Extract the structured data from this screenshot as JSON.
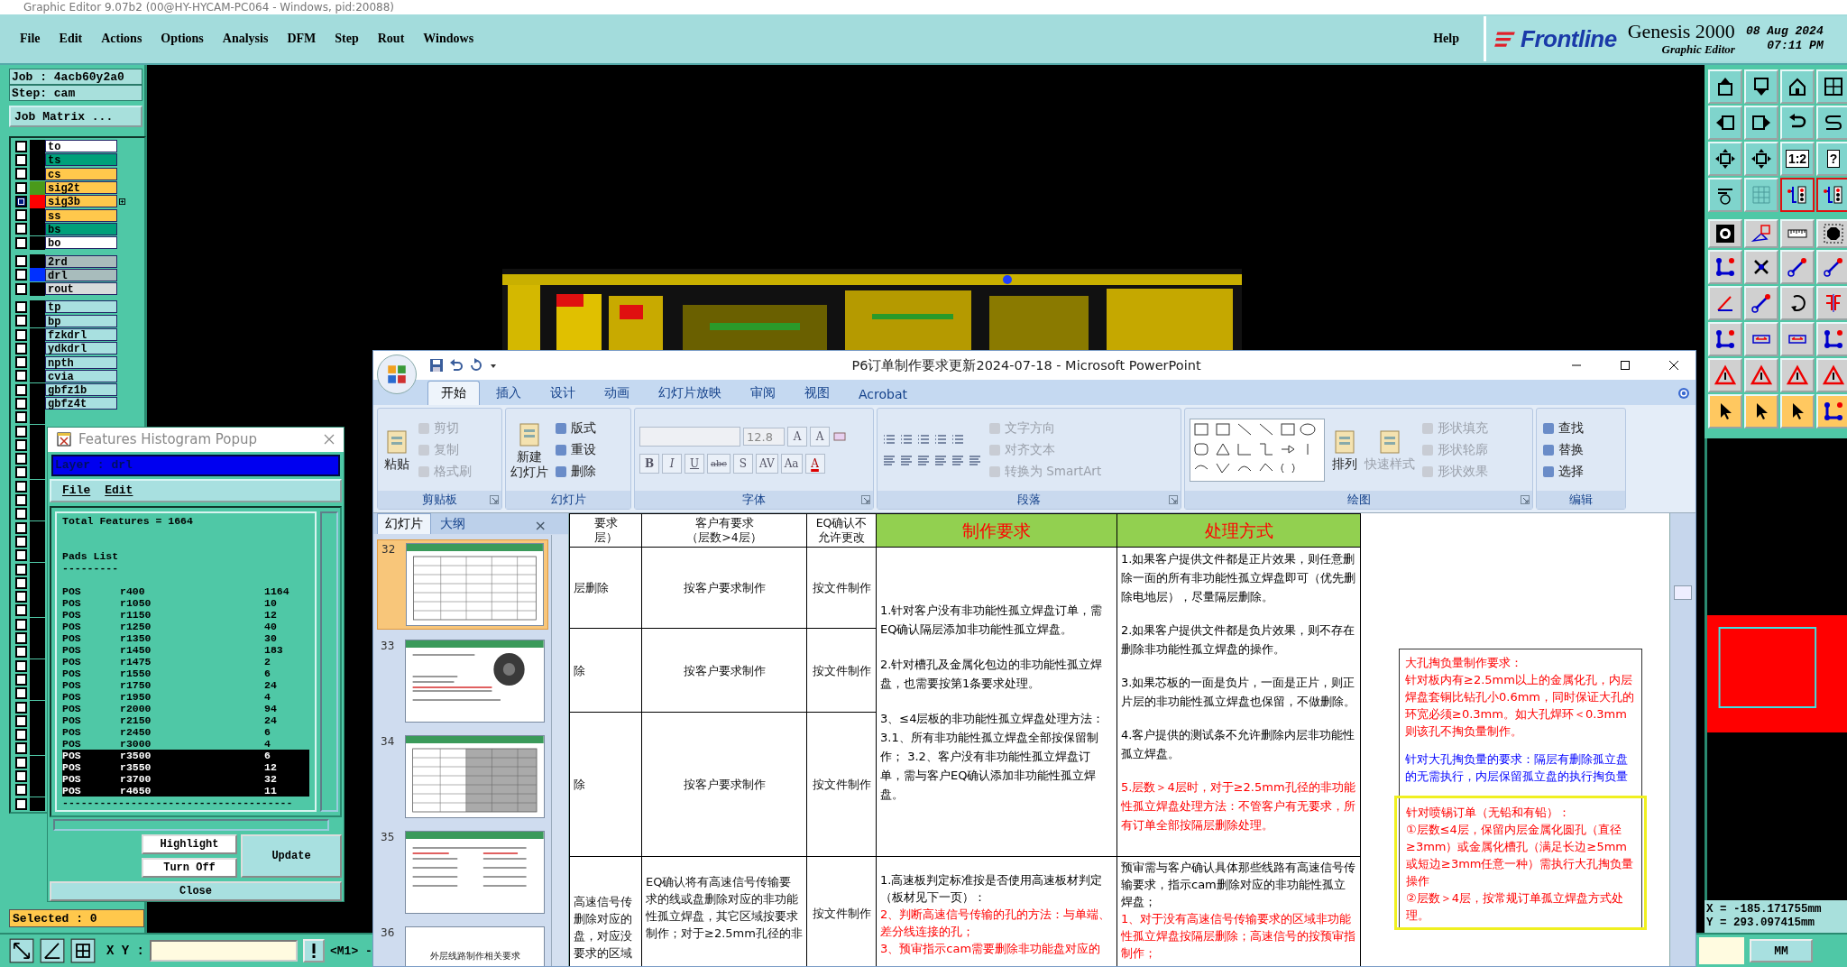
{
  "genesis": {
    "title": "Graphic Editor 9.07b2 (00@HY-HYCAM-PC064 - Windows, pid:20088)",
    "menu": [
      "File",
      "Edit",
      "Actions",
      "Options",
      "Analysis",
      "DFM",
      "Step",
      "Rout",
      "Windows"
    ],
    "help": "Help",
    "brand": {
      "logo": "Frontline",
      "product": "Genesis 2000",
      "subtitle": "Graphic Editor",
      "date": "08 Aug 2024",
      "time": "07:11 PM"
    },
    "job": "Job : 4acb60y2a0",
    "step": "Step: cam",
    "job_matrix": "Job Matrix ...",
    "layer_groups": [
      [
        {
          "name": "to",
          "color": "#ffffff",
          "swatch": {
            "color": "#000000"
          },
          "selected": false
        },
        {
          "name": "ts",
          "color": "#00a07a",
          "swatch": {
            "color": "#000000"
          },
          "selected": false
        },
        {
          "name": "cs",
          "color": "#ffc84c",
          "swatch": {
            "color": "#000000"
          },
          "selected": false
        },
        {
          "name": "sig2t",
          "color": "#ffc84c",
          "swatch": {
            "color": "#4a9a1a"
          },
          "selected": false
        },
        {
          "name": "sig3b",
          "color": "#ffc84c",
          "swatch": {
            "color": "#ff0000"
          },
          "selected": true,
          "marked": true
        },
        {
          "name": "ss",
          "color": "#ffc84c",
          "swatch": {
            "color": "#000000"
          },
          "selected": false
        },
        {
          "name": "bs",
          "color": "#00a07a",
          "swatch": {
            "color": "#000000"
          },
          "selected": false
        },
        {
          "name": "bo",
          "color": "#ffffff",
          "swatch": {
            "color": "#000000"
          },
          "selected": false
        }
      ],
      [
        {
          "name": "2rd",
          "color": "#a8bcbc",
          "swatch": {
            "color": "#000000"
          },
          "selected": false
        },
        {
          "name": "drl",
          "color": "#a8bcbc",
          "swatch": {
            "color": "#0030ff"
          },
          "selected": false
        },
        {
          "name": "rout",
          "color": "#d8dcdc",
          "swatch": {
            "color": "#000000"
          },
          "selected": false
        }
      ],
      [
        {
          "name": "tp",
          "color": "#a8e0e0",
          "swatch": {
            "color": "#000000"
          },
          "selected": false
        },
        {
          "name": "bp",
          "color": "#a8e0e0",
          "swatch": {
            "color": "#000000"
          },
          "selected": false
        },
        {
          "name": "fzkdrl",
          "color": "#a8e0e0",
          "swatch": {
            "color": "#000000"
          },
          "selected": false
        },
        {
          "name": "ydkdrl",
          "color": "#a8e0e0",
          "swatch": {
            "color": "#000000"
          },
          "selected": false
        },
        {
          "name": "npth",
          "color": "#a8e0e0",
          "swatch": {
            "color": "#000000"
          },
          "selected": false
        },
        {
          "name": "cvia",
          "color": "#a8e0e0",
          "swatch": {
            "color": "#000000"
          },
          "selected": false
        },
        {
          "name": "gbfz1b",
          "color": "#a8e0e0",
          "swatch": {
            "color": "#000000"
          },
          "selected": false
        },
        {
          "name": "gbfz4t",
          "color": "#a8e0e0",
          "swatch": {
            "color": "#000000"
          },
          "selected": false
        },
        {
          "selected": false,
          "swatch": {
            "color": "#000000"
          }
        },
        {
          "selected": false,
          "swatch": {
            "color": "#000000"
          }
        },
        {
          "selected": false,
          "swatch": {
            "color": "#000000"
          }
        },
        {
          "selected": false,
          "swatch": {
            "color": "#000000"
          }
        },
        {
          "selected": false,
          "swatch": {
            "color": "#000000"
          }
        },
        {
          "selected": false,
          "swatch": {
            "color": "#000000"
          }
        },
        {
          "selected": false,
          "swatch": {
            "color": "#000000"
          }
        },
        {
          "selected": false,
          "swatch": {
            "color": "#000000"
          }
        },
        {
          "selected": false,
          "swatch": {
            "color": "#000000"
          }
        },
        {
          "selected": false,
          "swatch": {
            "color": "#000000"
          }
        },
        {
          "selected": false,
          "swatch": {
            "color": "#000000"
          }
        },
        {
          "selected": false,
          "swatch": {
            "color": "#000000"
          }
        },
        {
          "selected": false,
          "swatch": {
            "color": "#000000"
          }
        },
        {
          "selected": false,
          "swatch": {
            "color": "#000000"
          }
        },
        {
          "selected": false,
          "swatch": {
            "color": "#000000"
          }
        },
        {
          "selected": false,
          "swatch": {
            "color": "#000000"
          }
        },
        {
          "selected": false,
          "swatch": {
            "color": "#000000"
          }
        },
        {
          "selected": false,
          "swatch": {
            "color": "#000000"
          }
        },
        {
          "selected": false,
          "swatch": {
            "color": "#000000"
          }
        },
        {
          "selected": false,
          "swatch": {
            "color": "#000000"
          }
        },
        {
          "selected": false,
          "swatch": {
            "color": "#000000"
          }
        },
        {
          "selected": false,
          "swatch": {
            "color": "#000000"
          }
        },
        {
          "selected": false,
          "swatch": {
            "color": "#000000"
          }
        },
        {
          "selected": false,
          "swatch": {
            "color": "#000000"
          }
        },
        {
          "selected": false,
          "swatch": {
            "color": "#000000"
          }
        },
        {
          "selected": false,
          "swatch": {
            "color": "#000000"
          }
        },
        {
          "selected": false,
          "swatch": {
            "color": "#000000"
          }
        },
        {
          "selected": false,
          "swatch": {
            "color": "#000000"
          }
        },
        {
          "selected": false,
          "swatch": {
            "color": "#000000"
          }
        }
      ]
    ],
    "selected_count": "Selected : 0",
    "xy_label": "X Y :",
    "mode": "<M1> -",
    "units": "MM",
    "coords": [
      "X = -185.171755mm",
      "Y = 293.097415mm"
    ],
    "tools": [
      {
        "kind": "up",
        "on": false
      },
      {
        "kind": "down",
        "on": false
      },
      {
        "kind": "home",
        "on": false
      },
      {
        "kind": "panel",
        "on": false
      },
      {
        "kind": "left",
        "on": false
      },
      {
        "kind": "right",
        "on": false
      },
      {
        "kind": "undo",
        "on": false
      },
      {
        "kind": "curve",
        "on": false
      },
      {
        "kind": "expand",
        "on": false
      },
      {
        "kind": "expand",
        "on": false
      },
      {
        "kind": "text",
        "label": "1:2",
        "on": false
      },
      {
        "kind": "text",
        "label": "?",
        "on": false
      },
      {
        "kind": "tools",
        "on": false
      },
      {
        "kind": "grid",
        "on": false
      },
      {
        "kind": "signal",
        "on": true
      },
      {
        "kind": "signal",
        "on": true
      },
      {
        "kind": "target",
        "on": false
      },
      {
        "kind": "shapes",
        "on": false
      },
      {
        "kind": "ruler",
        "on": false
      },
      {
        "kind": "octagon",
        "on": false
      },
      {
        "kind": "nodes",
        "on": false
      },
      {
        "kind": "cross",
        "on": false
      },
      {
        "kind": "segment",
        "on": false
      },
      {
        "kind": "segment",
        "on": false
      },
      {
        "kind": "angle",
        "on": false
      },
      {
        "kind": "segment",
        "on": false
      },
      {
        "kind": "rotate",
        "on": false
      },
      {
        "kind": "mirror",
        "on": false
      },
      {
        "kind": "nodes",
        "on": false
      },
      {
        "kind": "resize",
        "on": false
      },
      {
        "kind": "resize",
        "on": false
      },
      {
        "kind": "nodes",
        "on": false
      },
      {
        "kind": "triangle",
        "on": false
      },
      {
        "kind": "triangle",
        "on": false
      },
      {
        "kind": "triangle",
        "on": false
      },
      {
        "kind": "triangle",
        "on": false
      },
      {
        "kind": "pointer",
        "on": false
      },
      {
        "kind": "pointer",
        "on": false
      },
      {
        "kind": "pointer",
        "on": false
      },
      {
        "kind": "nodes",
        "on": false
      }
    ]
  },
  "histogram": {
    "title": "Features Histogram Popup",
    "layer": "Layer :  drl",
    "menu": [
      "File",
      "Edit"
    ],
    "total": "Total Features = 1664",
    "section": "Pads List",
    "rule": "---------",
    "rows": [
      {
        "type": "POS",
        "size": "r400",
        "count": "1164",
        "selected": false
      },
      {
        "type": "POS",
        "size": "r1050",
        "count": "10",
        "selected": false
      },
      {
        "type": "POS",
        "size": "r1150",
        "count": "12",
        "selected": false
      },
      {
        "type": "POS",
        "size": "r1250",
        "count": "40",
        "selected": false
      },
      {
        "type": "POS",
        "size": "r1350",
        "count": "30",
        "selected": false
      },
      {
        "type": "POS",
        "size": "r1450",
        "count": "183",
        "selected": false
      },
      {
        "type": "POS",
        "size": "r1475",
        "count": "2",
        "selected": false
      },
      {
        "type": "POS",
        "size": "r1550",
        "count": "6",
        "selected": false
      },
      {
        "type": "POS",
        "size": "r1750",
        "count": "24",
        "selected": false
      },
      {
        "type": "POS",
        "size": "r1950",
        "count": "4",
        "selected": false
      },
      {
        "type": "POS",
        "size": "r2000",
        "count": "94",
        "selected": false
      },
      {
        "type": "POS",
        "size": "r2150",
        "count": "24",
        "selected": false
      },
      {
        "type": "POS",
        "size": "r2450",
        "count": "6",
        "selected": false
      },
      {
        "type": "POS",
        "size": "r3000",
        "count": "4",
        "selected": false
      },
      {
        "type": "POS",
        "size": "r3500",
        "count": "6",
        "selected": true
      },
      {
        "type": "POS",
        "size": "r3550",
        "count": "12",
        "selected": true
      },
      {
        "type": "POS",
        "size": "r3700",
        "count": "32",
        "selected": true
      },
      {
        "type": "POS",
        "size": "r4650",
        "count": "11",
        "selected": true
      }
    ],
    "end_rule": "-------------------------------------",
    "buttons": [
      "Highlight",
      "Turn Off"
    ],
    "update": "Update",
    "close": "Close"
  },
  "powerpoint": {
    "title": "P6订单制作要求更新2024-07-18 - Microsoft PowerPoint",
    "tabs": [
      {
        "label": "开始",
        "selected": true
      },
      {
        "label": "插入",
        "selected": false
      },
      {
        "label": "设计",
        "selected": false
      },
      {
        "label": "动画",
        "selected": false
      },
      {
        "label": "幻灯片放映",
        "selected": false
      },
      {
        "label": "审阅",
        "selected": false
      },
      {
        "label": "视图",
        "selected": false
      },
      {
        "label": "Acrobat",
        "selected": false
      }
    ],
    "groups": [
      {
        "label": "剪贴板",
        "kind": "basic",
        "launcher": true,
        "big": [
          {
            "lines": [
              "粘贴"
            ],
            "disabled": false
          }
        ],
        "items": [
          {
            "label": "剪切",
            "disabled": true
          },
          {
            "label": "复制",
            "disabled": true
          },
          {
            "label": "格式刷",
            "disabled": true
          }
        ]
      },
      {
        "label": "幻灯片",
        "kind": "basic",
        "launcher": false,
        "big": [
          {
            "lines": [
              "新建",
              "幻灯片"
            ],
            "disabled": false
          }
        ],
        "items": [
          {
            "label": "版式",
            "disabled": false
          },
          {
            "label": "重设",
            "disabled": false
          },
          {
            "label": "删除",
            "disabled": false
          }
        ]
      },
      {
        "label": "字体",
        "kind": "font",
        "launcher": true,
        "size": "12.8",
        "buttons": [
          "A",
          "A",
          "B",
          "I",
          "U",
          "abc",
          "S",
          "AV",
          "Aa",
          "A"
        ]
      },
      {
        "label": "段落",
        "kind": "paragraph",
        "launcher": true,
        "items": [
          {
            "label": "文字方向",
            "disabled": true
          },
          {
            "label": "对齐文本",
            "disabled": true
          },
          {
            "label": "转换为 SmartArt",
            "disabled": true
          }
        ]
      },
      {
        "label": "绘图",
        "kind": "drawing",
        "launcher": true,
        "big": [
          {
            "lines": [
              "排列"
            ],
            "disabled": false
          },
          {
            "lines": [
              "快速样式"
            ],
            "disabled": true
          }
        ],
        "items": [
          {
            "label": "形状填充",
            "disabled": true
          },
          {
            "label": "形状轮廓",
            "disabled": true
          },
          {
            "label": "形状效果",
            "disabled": true
          }
        ]
      },
      {
        "label": "编辑",
        "kind": "basic",
        "launcher": false,
        "items": [
          {
            "label": "查找",
            "disabled": false
          },
          {
            "label": "替换",
            "disabled": false
          },
          {
            "label": "选择",
            "disabled": false
          }
        ]
      }
    ],
    "panel_tabs": [
      {
        "label": "幻灯片",
        "selected": true
      },
      {
        "label": "大纲",
        "selected": false
      }
    ],
    "panel_close": "×",
    "slides": [
      {
        "number": "32",
        "kind": "table",
        "selected": true
      },
      {
        "number": "33",
        "selected": false
      },
      {
        "number": "34",
        "kind": "grid",
        "selected": false
      },
      {
        "number": "35",
        "kind": "text",
        "selected": false
      },
      {
        "number": "36",
        "kind": "title",
        "title": "外层线路制作相关要求",
        "selected": false
      }
    ],
    "table": {
      "header": [
        [
          "要求",
          "层）"
        ],
        [
          "客户有要求",
          "（层数>4层）"
        ],
        [
          "EQ确认不",
          "允许更改"
        ],
        [
          "制作要求"
        ],
        [
          "处理方式"
        ]
      ],
      "rows": [
        [
          "层删除",
          "按客户要求制作",
          "按文件制作"
        ],
        [
          "除",
          "按客户要求制作",
          "按文件制作"
        ],
        [
          "除",
          "按客户要求制作",
          "按文件制作"
        ]
      ],
      "requirements": [
        {
          "text": "1.针对客户没有非功能性孤立焊盘订单，需EQ确认隔层添加非功能性孤立焊盘。",
          "color": "#000000"
        },
        {
          "text": "2.针对槽孔及金属化包边的非功能性孤立焊盘，也需要按第1条要求处理。",
          "color": "#000000"
        },
        {
          "text": "3、≤4层板的非功能性孤立焊盘处理方法：3.1、所有非功能性孤立焊盘全部按保留制作；                    3.2、客户没有非功能性孤立焊盘订单，需与客户EQ确认添加非功能性孤立焊盘。",
          "color": "#000000"
        }
      ],
      "handling": [
        {
          "text": "1.如果客户提供文件都是正片效果，则任意删除一面的所有非功能性孤立焊盘即可（优先删除电地层），尽量隔层删除。",
          "color": "#000000"
        },
        {
          "text": "2.如果客户提供文件都是负片效果，则不存在删除非功能性孤立焊盘的操作。",
          "color": "#000000"
        },
        {
          "text": "3.如果芯板的一面是负片，一面是正片，则正片层的非功能性孤立焊盘也保留，不做删除。",
          "color": "#000000"
        },
        {
          "text": "4.客户提供的测试条不允许删除内层非功能性孤立焊盘。",
          "color": "#000000"
        },
        {
          "text": "5.层数＞4层时，对于≥2.5mm孔径的非功能性孤立焊盘处理方法：不管客户有无要求，所有订单全部按隔层删除处理。",
          "color": "#ff0000"
        }
      ],
      "last_row": [
        "高速信号传删除对应的盘，对应没要求的区域",
        "EQ确认将有高速信号传输要求的线或盘删除对应的非功能性孤立焊盘，其它区域按要求制作；对于≥2.5mm孔径的非",
        "按文件制作"
      ],
      "last_requirements": [
        {
          "text": "1.高速板判定标准按是否使用高速板材判定（板材见下一页）：",
          "color": "#000000"
        },
        {
          "text": "2、判断高速信号传输的孔的方法：与单端、差分线连接的孔；",
          "color": "#ff0000"
        },
        {
          "text": "3、预审指示cam需要删除非功能盘对应的",
          "color": "#ff0000"
        }
      ],
      "last_handling": [
        {
          "text": "预审需与客户确认具体那些线路有高速信号传输要求，指示cam删除对应的非功能性孤立焊盘；",
          "color": "#000000"
        },
        {
          "text": "1、对于没有高速信号传输要求的区域非功能性孤立焊盘按隔层删除；高速信号的按预审指制作；",
          "color": "#ff0000"
        }
      ]
    },
    "note": {
      "blocks": [
        {
          "color": "#ff0000",
          "lines": [
            "大孔掏负量制作要求：",
            "针对板内有≥2.5mm以上的金属化孔，内层焊盘套铜比钻孔小0.6mm，同时保证大孔的环宽必须≥0.3mm。如大孔焊环＜0.3mm则该孔不掏负量制作。"
          ]
        },
        {
          "color": "#0000ff",
          "lines": [
            "针对大孔掏负量的要求：隔层有删除孤立盘的无需执行，内层保留孤立盘的执行掏负量"
          ]
        }
      ],
      "highlight": {
        "color": "#ff0000",
        "lines": [
          "针对喷锡订单（无铅和有铅）：",
          "①层数≤4层，保留内层金属化圆孔（直径≥3mm）或金属化槽孔（满足长边≥5mm或短边≥3mm任意一种）需执行大孔掏负量操作",
          "②层数＞4层，按常规订单孤立焊盘方式处理。"
        ]
      }
    }
  }
}
